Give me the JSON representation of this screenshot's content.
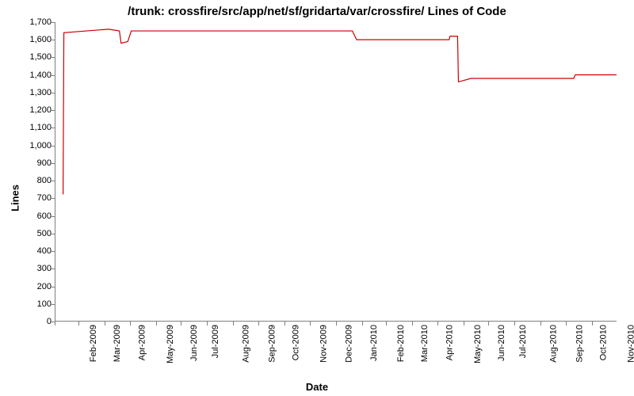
{
  "chart_data": {
    "type": "line",
    "title": "/trunk: crossfire/src/app/net/sf/gridarta/var/crossfire/ Lines of Code",
    "xlabel": "Date",
    "ylabel": "Lines",
    "ylim": [
      0,
      1700
    ],
    "x_ticks": [
      "Feb-2009",
      "Mar-2009",
      "Apr-2009",
      "May-2009",
      "Jun-2009",
      "Jul-2009",
      "Aug-2009",
      "Sep-2009",
      "Oct-2009",
      "Nov-2009",
      "Dec-2009",
      "Jan-2010",
      "Feb-2010",
      "Mar-2010",
      "Apr-2010",
      "May-2010",
      "Jun-2010",
      "Jul-2010",
      "Aug-2010",
      "Sep-2010",
      "Oct-2010",
      "Nov-2010"
    ],
    "y_ticks": [
      0,
      100,
      200,
      300,
      400,
      500,
      600,
      700,
      800,
      900,
      1000,
      1100,
      1200,
      1300,
      1400,
      1500,
      1600,
      1700
    ],
    "y_tick_labels": [
      "0",
      "100",
      "200",
      "300",
      "400",
      "500",
      "600",
      "700",
      "800",
      "900",
      "1,000",
      "1,100",
      "1,200",
      "1,300",
      "1,400",
      "1,500",
      "1,600",
      "1,700"
    ],
    "series": [
      {
        "name": "Lines of Code",
        "color": "#cc0000",
        "points": [
          {
            "x": "2009-02-10",
            "y": 720
          },
          {
            "x": "2009-02-11",
            "y": 1640
          },
          {
            "x": "2009-04-05",
            "y": 1660
          },
          {
            "x": "2009-04-18",
            "y": 1650
          },
          {
            "x": "2009-04-20",
            "y": 1580
          },
          {
            "x": "2009-04-28",
            "y": 1590
          },
          {
            "x": "2009-05-02",
            "y": 1650
          },
          {
            "x": "2010-01-20",
            "y": 1650
          },
          {
            "x": "2010-01-25",
            "y": 1600
          },
          {
            "x": "2010-05-15",
            "y": 1600
          },
          {
            "x": "2010-05-16",
            "y": 1620
          },
          {
            "x": "2010-05-25",
            "y": 1620
          },
          {
            "x": "2010-05-26",
            "y": 1360
          },
          {
            "x": "2010-06-10",
            "y": 1380
          },
          {
            "x": "2010-10-10",
            "y": 1380
          },
          {
            "x": "2010-10-12",
            "y": 1400
          },
          {
            "x": "2010-11-30",
            "y": 1400
          }
        ]
      }
    ]
  }
}
